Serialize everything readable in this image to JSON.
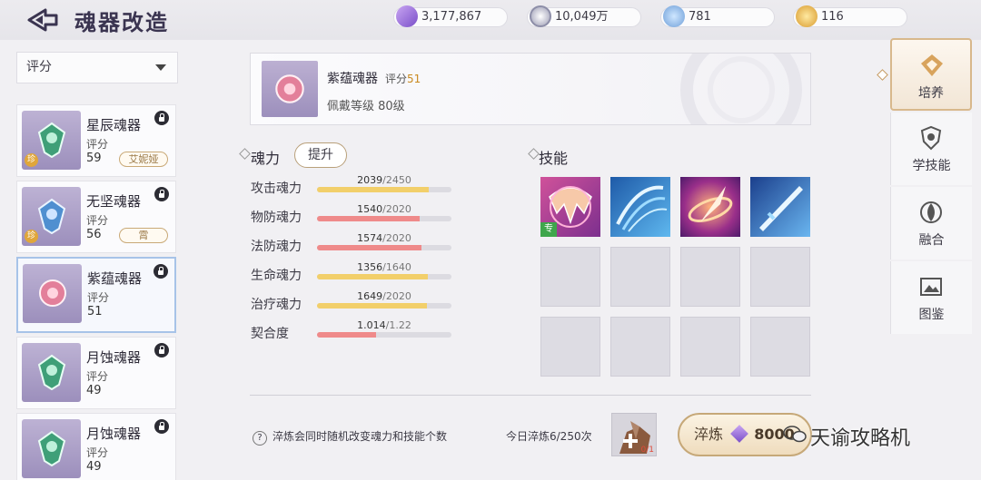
{
  "header": {
    "title": "魂器改造",
    "resources": [
      {
        "icon": "purple-crystal-icon",
        "value": "3,177,867"
      },
      {
        "icon": "silver-coin-icon",
        "value": "10,049万"
      },
      {
        "icon": "blue-gem-bag-icon",
        "value": "781"
      },
      {
        "icon": "gold-coin-bag-icon",
        "value": "116"
      }
    ]
  },
  "sidebar": {
    "sort_label": "评分",
    "items": [
      {
        "name": "星辰魂器",
        "score_label": "评分",
        "score": "59",
        "owner": "艾妮娅",
        "rare": "珍",
        "lock": "locked",
        "gem_color": "#3f9f78"
      },
      {
        "name": "无坚魂器",
        "score_label": "评分",
        "score": "56",
        "owner": "霄",
        "rare": "珍",
        "lock": "locked",
        "gem_color": "#4f8fd0"
      },
      {
        "name": "紫蕴魂器",
        "score_label": "评分",
        "score": "51",
        "owner": "",
        "rare": "",
        "lock": "unlocked",
        "gem_color": "#d05a7a"
      },
      {
        "name": "月蚀魂器",
        "score_label": "评分",
        "score": "49",
        "owner": "",
        "rare": "",
        "lock": "locked",
        "gem_color": "#3f9f78"
      },
      {
        "name": "月蚀魂器",
        "score_label": "评分",
        "score": "49",
        "owner": "",
        "rare": "",
        "lock": "unlocked",
        "gem_color": "#3f9f78"
      }
    ]
  },
  "selected": {
    "name": "紫蕴魂器",
    "score_label": "评分",
    "score": "51",
    "level": "佩戴等级 80级"
  },
  "soul_power": {
    "title": "魂力",
    "upgrade_label": "提升",
    "stats": [
      {
        "label": "攻击魂力",
        "current": "2039",
        "max": "/2450",
        "ratio": 0.832,
        "color": "#f2cf6a"
      },
      {
        "label": "物防魂力",
        "current": "1540",
        "max": "/2020",
        "ratio": 0.762,
        "color": "#ef8a8a"
      },
      {
        "label": "法防魂力",
        "current": "1574",
        "max": "/2020",
        "ratio": 0.779,
        "color": "#ef8a8a"
      },
      {
        "label": "生命魂力",
        "current": "1356",
        "max": "/1640",
        "ratio": 0.827,
        "color": "#f2cf6a"
      },
      {
        "label": "治疗魂力",
        "current": "1649",
        "max": "/2020",
        "ratio": 0.816,
        "color": "#f2cf6a"
      },
      {
        "label": "契合度",
        "current": "1.014",
        "max": "/1.22",
        "ratio": 0.44,
        "color": "#ef8a8a"
      }
    ]
  },
  "skills": {
    "title": "技能",
    "slots": [
      {
        "icon": "bat-wing-skill-icon",
        "filled": true,
        "badge": "专"
      },
      {
        "icon": "blue-slash-skill-icon",
        "filled": true,
        "badge": ""
      },
      {
        "icon": "purple-blade-skill-icon",
        "filled": true,
        "badge": ""
      },
      {
        "icon": "blue-sword-skill-icon",
        "filled": true,
        "badge": ""
      },
      {
        "filled": false
      },
      {
        "filled": false
      },
      {
        "filled": false
      },
      {
        "filled": false
      },
      {
        "filled": false
      },
      {
        "filled": false
      },
      {
        "filled": false
      },
      {
        "filled": false
      }
    ]
  },
  "footer": {
    "tip": "淬炼会同时随机改变魂力和技能个数",
    "daily": "今日淬炼6/250次",
    "material_count": "0/1",
    "refine_label": "淬炼",
    "refine_cost": "8000",
    "watermark": "天谕攻略机"
  },
  "tabs": [
    {
      "label": "培养",
      "icon": "nurture-icon",
      "active": true
    },
    {
      "label": "学技能",
      "icon": "learn-skill-icon",
      "active": false
    },
    {
      "label": "融合",
      "icon": "fusion-icon",
      "active": false
    },
    {
      "label": "图鉴",
      "icon": "gallery-icon",
      "active": false
    }
  ],
  "colors": {
    "accent": "#d8b88c",
    "selected_border": "#a7c3e8",
    "gold_text": "#c98a20"
  }
}
